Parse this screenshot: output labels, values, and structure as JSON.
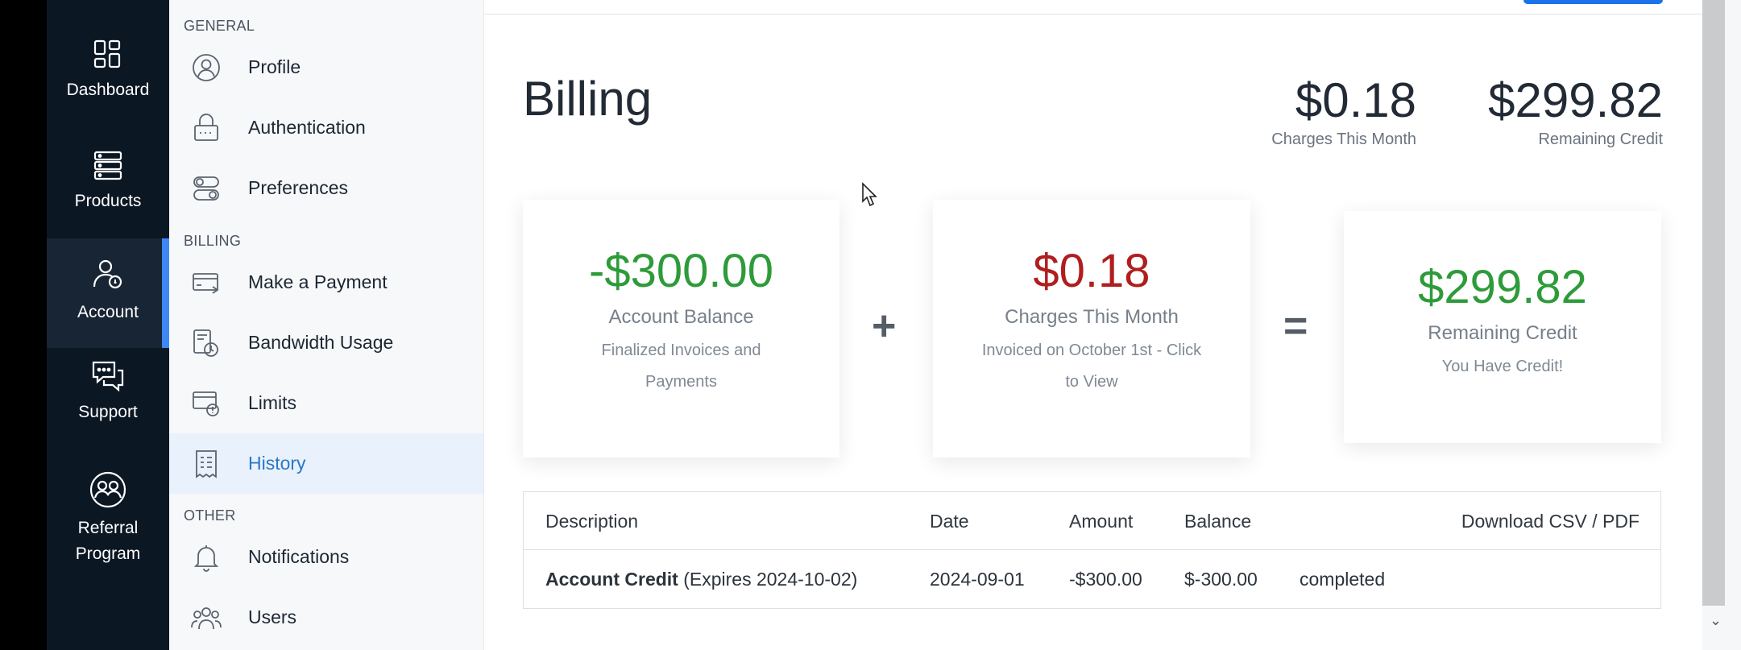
{
  "nav_rail": {
    "items": [
      {
        "label": "Dashboard",
        "icon": "dashboard-icon"
      },
      {
        "label": "Products",
        "icon": "products-icon"
      },
      {
        "label": "Account",
        "icon": "account-icon",
        "active": true
      },
      {
        "label": "Support",
        "icon": "support-icon"
      },
      {
        "label": "Referral Program",
        "icon": "referral-icon"
      }
    ]
  },
  "sidebar": {
    "general_title": "GENERAL",
    "billing_title": "BILLING",
    "other_title": "OTHER",
    "items": {
      "profile": "Profile",
      "authentication": "Authentication",
      "preferences": "Preferences",
      "make_payment": "Make a Payment",
      "bandwidth": "Bandwidth Usage",
      "limits": "Limits",
      "history": "History",
      "notifications": "Notifications",
      "users": "Users"
    }
  },
  "header": {
    "title": "Billing",
    "charges_value": "$0.18",
    "charges_label": "Charges This Month",
    "credit_value": "$299.82",
    "credit_label": "Remaining Credit"
  },
  "cards": {
    "balance": {
      "amount": "-$300.00",
      "name": "Account Balance",
      "sub_line1": "Finalized Invoices and",
      "sub_line2": "Payments"
    },
    "plus": "+",
    "charges": {
      "amount": "$0.18",
      "name": "Charges This Month",
      "sub_line1": "Invoiced on October 1st - Click",
      "sub_line2": "to View"
    },
    "equals": "=",
    "remaining": {
      "amount": "$299.82",
      "name": "Remaining Credit",
      "sub_line1": "You Have Credit!"
    }
  },
  "table": {
    "headers": {
      "description": "Description",
      "date": "Date",
      "amount": "Amount",
      "balance": "Balance",
      "download": "Download CSV / PDF"
    },
    "rows": [
      {
        "description_bold": "Account Credit",
        "description_rest": " (Expires 2024-10-02)",
        "date": "2024-09-01",
        "amount": "-$300.00",
        "balance": "$-300.00",
        "status": "completed"
      }
    ]
  },
  "colors": {
    "positive": "#2e9b3a",
    "negative": "#b01e1e",
    "accent": "#3f87f5",
    "rail_bg": "#0c1724"
  }
}
